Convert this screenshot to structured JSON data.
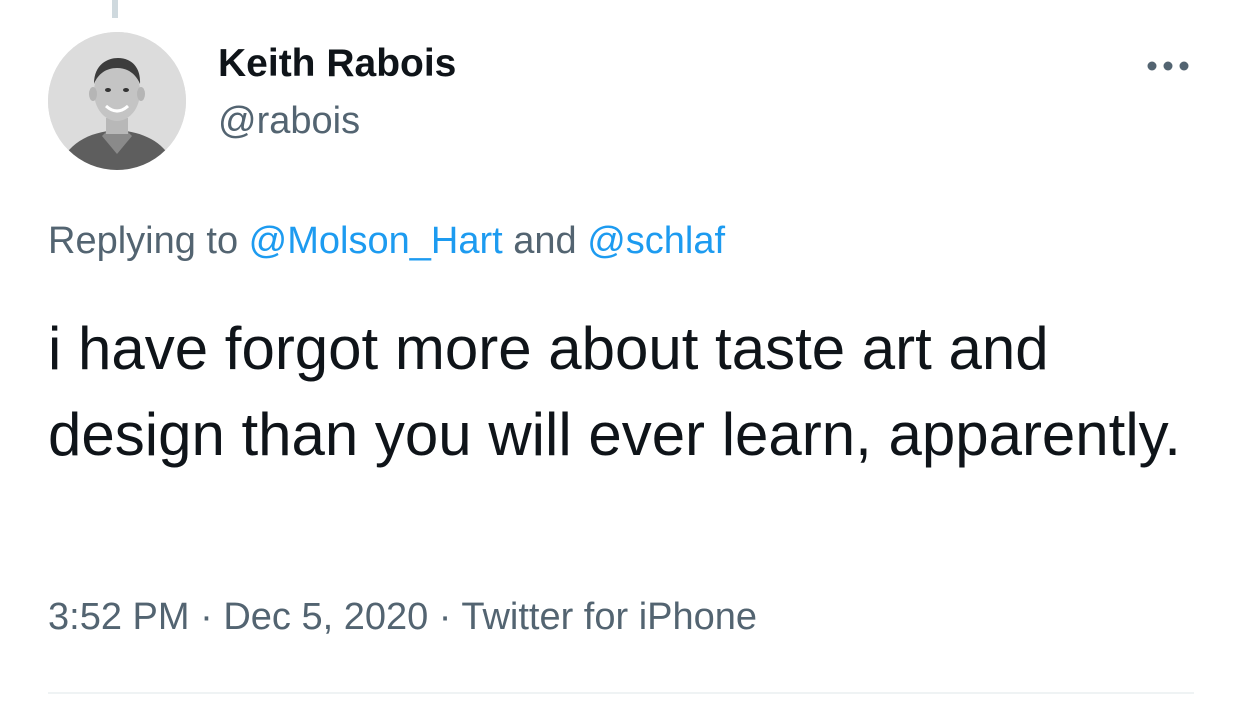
{
  "author": {
    "display_name": "Keith Rabois",
    "handle": "@rabois",
    "avatar_icon": "profile-photo"
  },
  "more_icon": "ellipsis-icon",
  "reply_context": {
    "prefix": "Replying to ",
    "mentions": [
      "@Molson_Hart",
      "@schlaf"
    ],
    "joiner": " and "
  },
  "tweet_text": "i have forgot more about taste art and design than you will ever learn, apparently.",
  "meta": {
    "time": "3:52 PM",
    "separator": " · ",
    "date": "Dec 5, 2020",
    "source": "Twitter for iPhone"
  },
  "colors": {
    "text": "#0f1419",
    "secondary": "#536471",
    "link": "#1d9bf0",
    "divider": "#eff3f4"
  }
}
